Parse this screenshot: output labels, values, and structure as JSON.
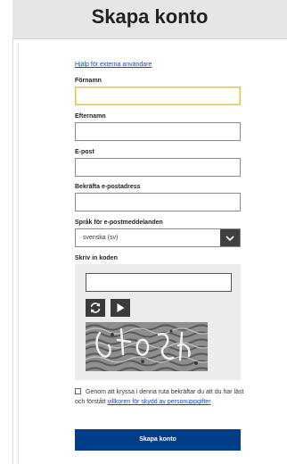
{
  "header": {
    "title": "Skapa konto"
  },
  "form": {
    "help_link": "Hjälp för externa användare",
    "first_name": {
      "label": "Förnamn",
      "value": ""
    },
    "last_name": {
      "label": "Efternamn",
      "value": ""
    },
    "email": {
      "label": "E-post",
      "value": ""
    },
    "confirm_email": {
      "label": "Bekräfta e-postadress",
      "value": ""
    },
    "language": {
      "label": "Språk för e-postmeddelanden",
      "selected": "svenska (sv)"
    },
    "captcha": {
      "label": "Skriv in koden",
      "value": ""
    },
    "consent": {
      "text_before": "Genom att kryssa i denna ruta bekräftar du att du har läst och förstått ",
      "link_text": "villkoren för skydd av personuppgifter",
      "checked": false
    },
    "submit_label": "Skapa konto"
  },
  "colors": {
    "accent": "#003e8a",
    "link": "#0e47cb",
    "focus_border": "#e0c24d"
  },
  "icons": {
    "refresh": "refresh-icon",
    "play": "play-icon",
    "dropdown": "chevron-down-icon"
  }
}
